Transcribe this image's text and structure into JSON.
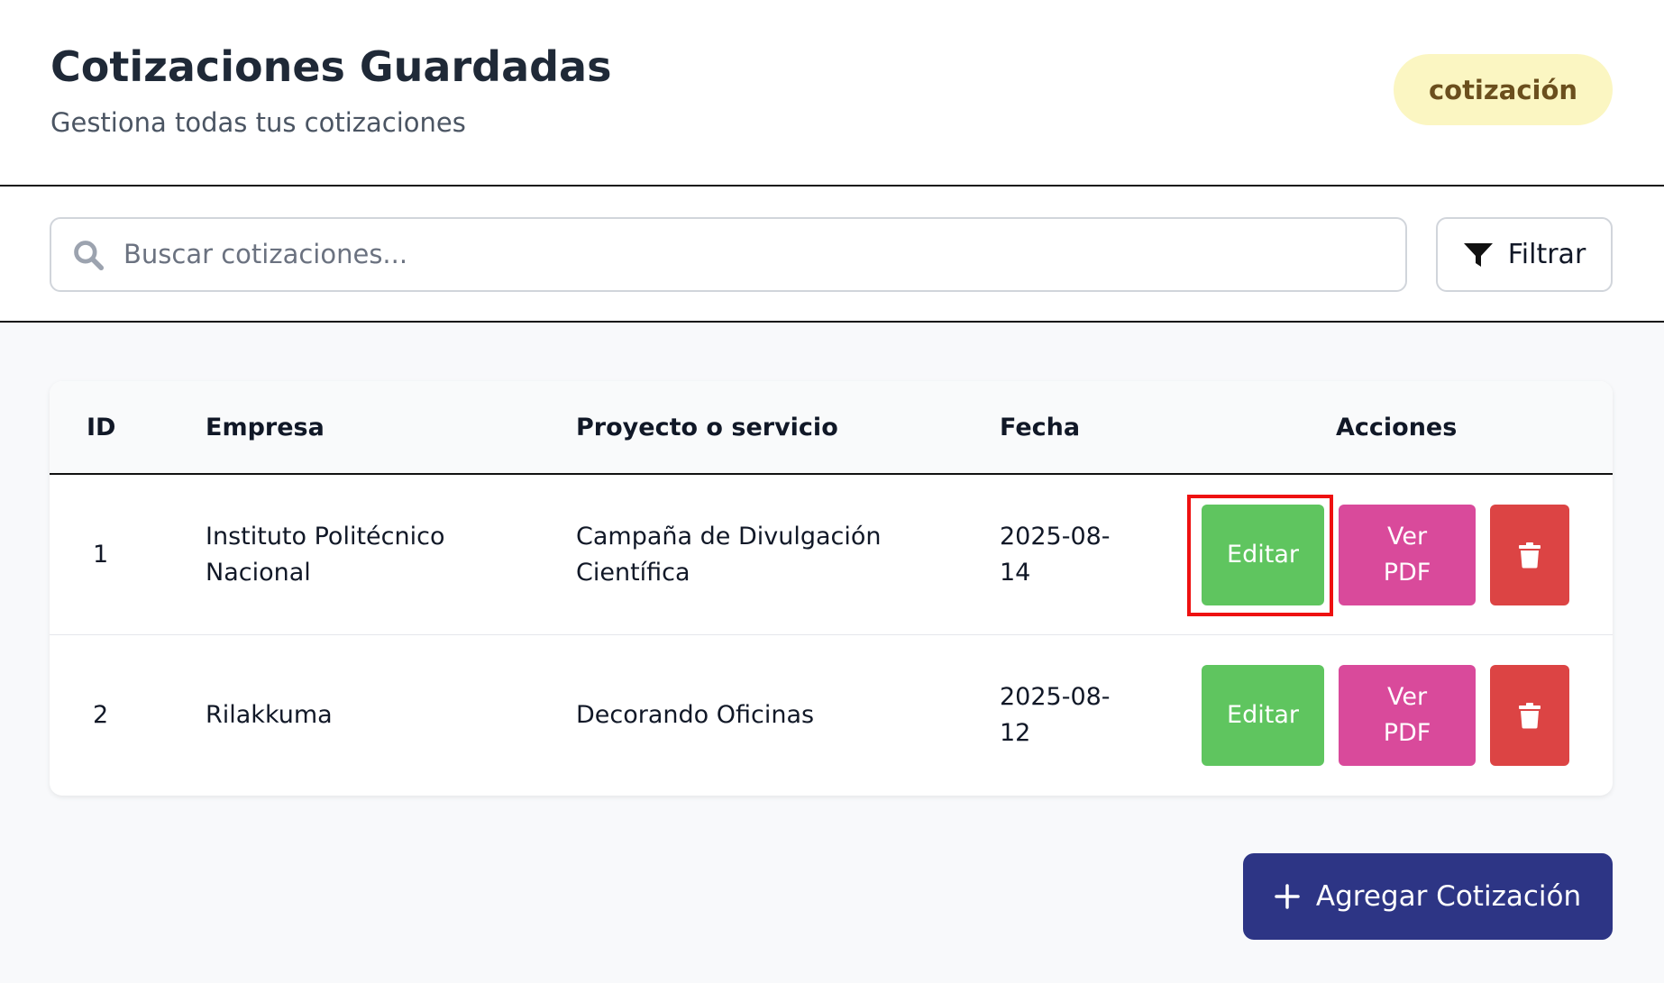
{
  "header": {
    "title": "Cotizaciones Guardadas",
    "subtitle": "Gestiona todas tus cotizaciones",
    "badge": "cotización"
  },
  "toolbar": {
    "search_placeholder": "Buscar cotizaciones...",
    "search_icon": "search-icon",
    "filter_label": "Filtrar",
    "filter_icon": "filter-icon"
  },
  "table": {
    "columns": [
      "ID",
      "Empresa",
      "Proyecto o servicio",
      "Fecha",
      "Acciones"
    ],
    "rows": [
      {
        "id": "1",
        "empresa": "Instituto Politécnico Nacional",
        "proyecto": "Campaña de Divulgación Científica",
        "fecha": "2025-08-14"
      },
      {
        "id": "2",
        "empresa": "Rilakkuma",
        "proyecto": "Decorando Oficinas",
        "fecha": "2025-08-12"
      }
    ],
    "actions": {
      "edit_label": "Editar",
      "pdf_label": "Ver PDF",
      "delete_icon": "trash-icon"
    }
  },
  "footer": {
    "add_label": "Agregar Cotización",
    "add_icon": "plus-icon"
  },
  "colors": {
    "edit": "#5fc55f",
    "pdf": "#d94a9b",
    "delete": "#dc4444",
    "primary": "#2d3585",
    "badge_bg": "#fbf6c2",
    "highlight": "#ee1111"
  }
}
